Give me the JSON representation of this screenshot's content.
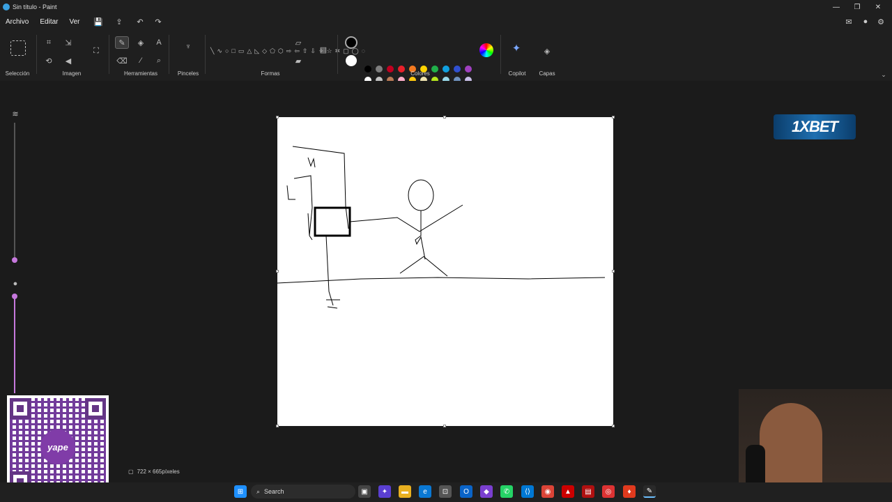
{
  "window": {
    "title": "Sin título - Paint"
  },
  "menu": {
    "items": [
      "Archivo",
      "Editar",
      "Ver"
    ]
  },
  "ribbon": {
    "groups": [
      "Selección",
      "Imagen",
      "Herramientas",
      "Pinceles",
      "Formas",
      "Colores",
      "Copilot",
      "Capas"
    ]
  },
  "colors": {
    "primary": "#000000",
    "secondary": "#ffffff",
    "row1": [
      "#000000",
      "#7f7f7f",
      "#c00020",
      "#e8202a",
      "#f47a20",
      "#ffd400",
      "#20b04a",
      "#10a0e0",
      "#3050d0",
      "#a040c0"
    ],
    "row2": [
      "#ffffff",
      "#c3c3c3",
      "#b97a57",
      "#ffaec9",
      "#ffc90e",
      "#efe4b0",
      "#b5e61d",
      "#99d9ea",
      "#7092be",
      "#c8bfe7"
    ]
  },
  "status": {
    "canvas_size": "722 × 665píxeles"
  },
  "taskbar": {
    "search_placeholder": "Search"
  },
  "overlays": {
    "brand_logo": "1XBET",
    "qr_label": "yape"
  }
}
